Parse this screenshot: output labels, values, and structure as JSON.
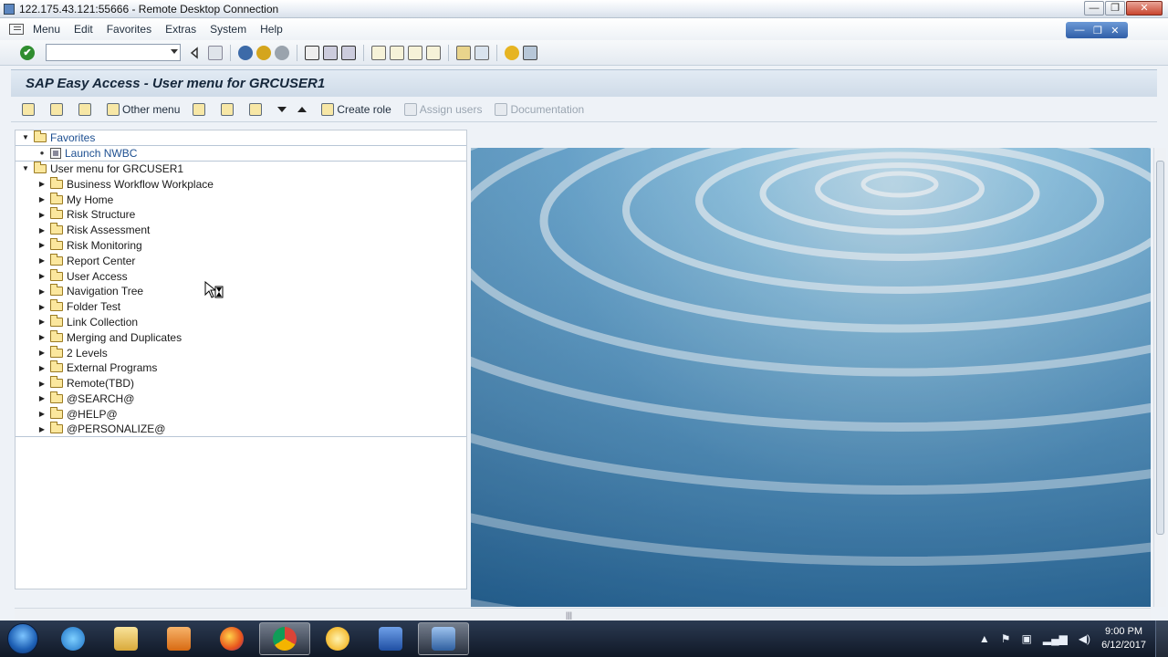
{
  "rdp": {
    "title": "122.175.43.121:55666 - Remote Desktop Connection",
    "min": "—",
    "restore": "❐",
    "close": "✕"
  },
  "menubar": {
    "items": [
      {
        "label": "Menu",
        "key": "M"
      },
      {
        "label": "Edit",
        "key": "E"
      },
      {
        "label": "Favorites",
        "key": "F"
      },
      {
        "label": "Extras",
        "key": "x"
      },
      {
        "label": "System",
        "key": "S"
      },
      {
        "label": "Help",
        "key": "H"
      }
    ],
    "winctrl": {
      "min": "—",
      "restore": "❐",
      "close": "✕"
    }
  },
  "toolbar": {
    "check": "✔",
    "command_value": ""
  },
  "title": {
    "text": "SAP Easy Access  -  User menu for GRCUSER1"
  },
  "app_toolbar": {
    "other_menu": "Other menu",
    "create_role": "Create role",
    "assign_users": "Assign users",
    "documentation": "Documentation"
  },
  "tree": {
    "favorites": "Favorites",
    "launch_nwbc": "Launch NWBC",
    "user_menu": "User menu for GRCUSER1",
    "folders": [
      "Business Workflow Workplace",
      "My Home",
      "Risk Structure",
      "Risk Assessment",
      "Risk Monitoring",
      "Report Center",
      "User Access",
      "Navigation Tree",
      "Folder Test",
      "Link Collection",
      "Merging and Duplicates",
      "2 Levels",
      "External Programs",
      "Remote(TBD)",
      "@SEARCH@",
      "@HELP@",
      "@PERSONALIZE@"
    ]
  },
  "taskbar": {
    "time": "9:00 PM",
    "date": "6/12/2017"
  },
  "colors": {
    "accent": "#1d4f91",
    "title_bg": "#cfdbe8",
    "taskbar": "#101826"
  }
}
